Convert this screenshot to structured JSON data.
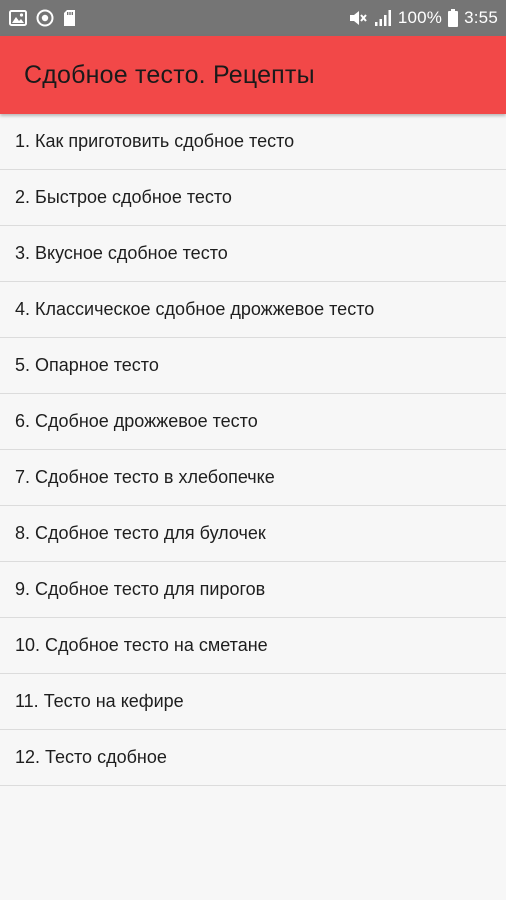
{
  "status_bar": {
    "left_icons": [
      "image-icon",
      "camera-lens-icon",
      "sd-card-icon"
    ],
    "right_icons": [
      "mute-icon",
      "signal-icon",
      "battery-icon"
    ],
    "battery": "100%",
    "time": "3:55"
  },
  "app_bar": {
    "title": "Сдобное тесто. Рецепты",
    "color": "#f24848"
  },
  "recipes": [
    {
      "label": "1. Как приготовить сдобное тесто"
    },
    {
      "label": "2. Быстрое сдобное тесто"
    },
    {
      "label": "3. Вкусное сдобное тесто"
    },
    {
      "label": "4. Классическое сдобное дрожжевое тесто"
    },
    {
      "label": "5. Опарное тесто"
    },
    {
      "label": "6. Сдобное дрожжевое тесто"
    },
    {
      "label": "7. Сдобное тесто в хлебопечке"
    },
    {
      "label": "8. Сдобное тесто для булочек"
    },
    {
      "label": "9. Сдобное тесто для пирогов"
    },
    {
      "label": "10. Сдобное тесто на сметане"
    },
    {
      "label": "11. Тесто на кефире"
    },
    {
      "label": "12. Тесто сдобное"
    }
  ]
}
